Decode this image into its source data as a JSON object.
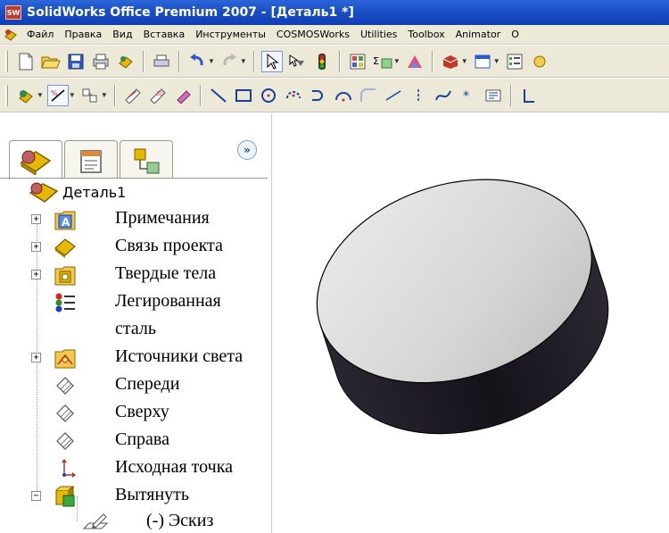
{
  "window": {
    "title": "SolidWorks Office Premium 2007 - [Деталь1 *]",
    "app_icon": "SW"
  },
  "menu": [
    "Файл",
    "Правка",
    "Вид",
    "Вставка",
    "Инструменты",
    "COSMOSWorks",
    "Utilities",
    "Toolbox",
    "Animator",
    "O"
  ],
  "feature_manager": {
    "expand_symbol": "»",
    "root": "Деталь1",
    "items": [
      {
        "label": "Примечания",
        "expander": "+",
        "icon": "annotations-icon"
      },
      {
        "label": "Связь проекта",
        "expander": "+",
        "icon": "design-binder-icon"
      },
      {
        "label": "Твердые тела",
        "expander": "+",
        "icon": "solid-bodies-icon"
      },
      {
        "label": "Легированная",
        "expander": "",
        "icon": "material-icon"
      },
      {
        "label": "сталь",
        "expander": "",
        "icon": ""
      },
      {
        "label": "Источники света",
        "expander": "+",
        "icon": "lights-icon"
      },
      {
        "label": "Спереди",
        "expander": "",
        "icon": "plane-icon"
      },
      {
        "label": "Сверху",
        "expander": "",
        "icon": "plane-icon"
      },
      {
        "label": "Справа",
        "expander": "",
        "icon": "plane-icon"
      },
      {
        "label": "Исходная точка",
        "expander": "",
        "icon": "origin-icon"
      },
      {
        "label": "Вытянуть",
        "expander": "−",
        "icon": "extrude-icon"
      },
      {
        "label": "(-) Эскиз",
        "expander": "",
        "icon": "sketch-icon"
      }
    ]
  },
  "colors": {
    "titlebar": "#1a4fc4",
    "toolbar_bg": "#ece9d8",
    "cylinder_top": "#d8d8d8",
    "cylinder_side": "#1e1a20"
  }
}
